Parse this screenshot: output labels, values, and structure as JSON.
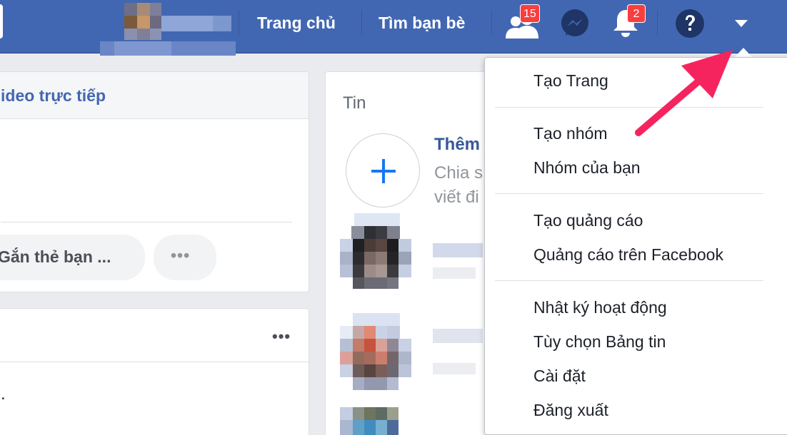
{
  "topbar": {
    "nav": [
      {
        "label": "Trang chủ"
      },
      {
        "label": "Tìm bạn bè"
      }
    ],
    "friend_requests_count": "15",
    "notifications_count": "2"
  },
  "composer": {
    "header_tab": "ideo trực tiếp",
    "tag_friends_label": "Gắn thẻ bạn ...",
    "more_label": "•••"
  },
  "post": {
    "more_label": "•••",
    "text_fragment": "."
  },
  "stories": {
    "title": "Tin",
    "add_title": "Thêm",
    "add_sub_line1": "Chia s",
    "add_sub_line2": "viết đi"
  },
  "menu": {
    "groups": [
      {
        "items": [
          "Tạo Trang"
        ]
      },
      {
        "items": [
          "Tạo nhóm",
          "Nhóm của bạn"
        ]
      },
      {
        "items": [
          "Tạo quảng cáo",
          "Quảng cáo trên Facebook"
        ]
      },
      {
        "items": [
          "Nhật ký hoạt động",
          "Tùy chọn Bảng tin",
          "Cài đặt",
          "Đăng xuất"
        ]
      }
    ]
  },
  "colors": {
    "brand_blue": "#4267b2",
    "badge_red": "#fa3e3e",
    "annotation_pink": "#f5245f",
    "link_blue": "#385898"
  }
}
